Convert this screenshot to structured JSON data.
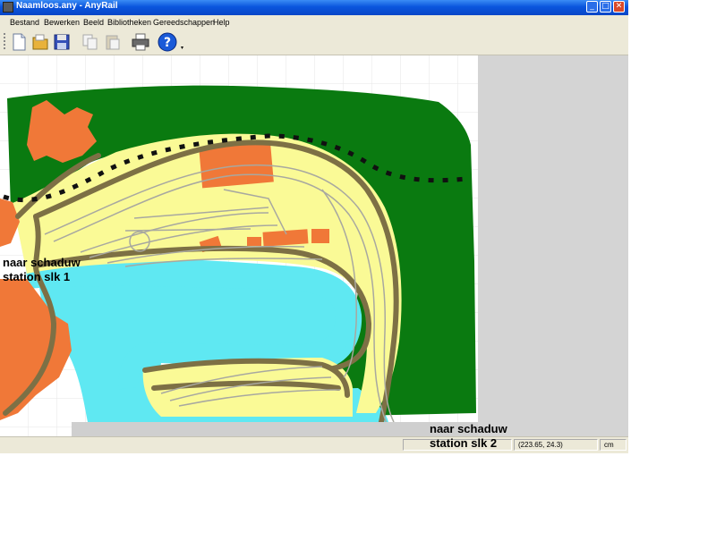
{
  "window": {
    "title": "Naamloos.any - AnyRail"
  },
  "titlebar_buttons": {
    "minimize": "_",
    "maximize": "□",
    "close": "✕"
  },
  "menu": [
    "Bestand",
    "Bewerken",
    "Beeld",
    "Bibliotheken",
    "Gereedschappen",
    "Help"
  ],
  "toolbar": {
    "tools": [
      "new-document-icon",
      "open-folder-icon",
      "save-disk-icon",
      "copy-icon",
      "paste-icon",
      "print-icon",
      "help-icon"
    ],
    "help_glyph": "?"
  },
  "labels": {
    "left_line1": "naar schaduw",
    "left_line2": "station slk 1",
    "right_line1": "naar schaduw",
    "right_line2": "station slk 2"
  },
  "status": {
    "coordinates": "(223.65, 24.3)",
    "unit": "cm"
  },
  "colors": {
    "forest": "#0a7a10",
    "land": "#fafa96",
    "water": "#5fe8f2",
    "buildings": "#f07838",
    "track_bed": "#7d7045",
    "rails": "#a8a8a0"
  }
}
